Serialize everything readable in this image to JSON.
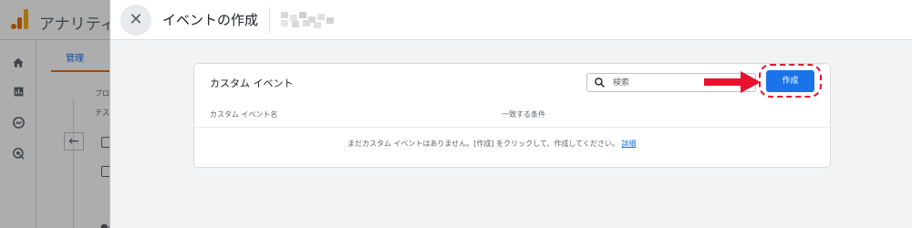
{
  "background": {
    "app_title": "アナリティ",
    "tab_label": "管理",
    "small_texts": [
      "プロ",
      "テス"
    ]
  },
  "dialog": {
    "title": "イベントの作成",
    "card": {
      "title": "カスタム イベント",
      "search": {
        "placeholder": "検索"
      },
      "create_label": "作成",
      "columns": [
        "カスタム イベント名",
        "一致する条件"
      ],
      "empty_message": "まだカスタム イベントはありません。[作成] をクリックして、作成してください。",
      "details_link": "詳細"
    }
  },
  "colors": {
    "accent": "#1a73e8",
    "highlight": "#e8112d"
  }
}
